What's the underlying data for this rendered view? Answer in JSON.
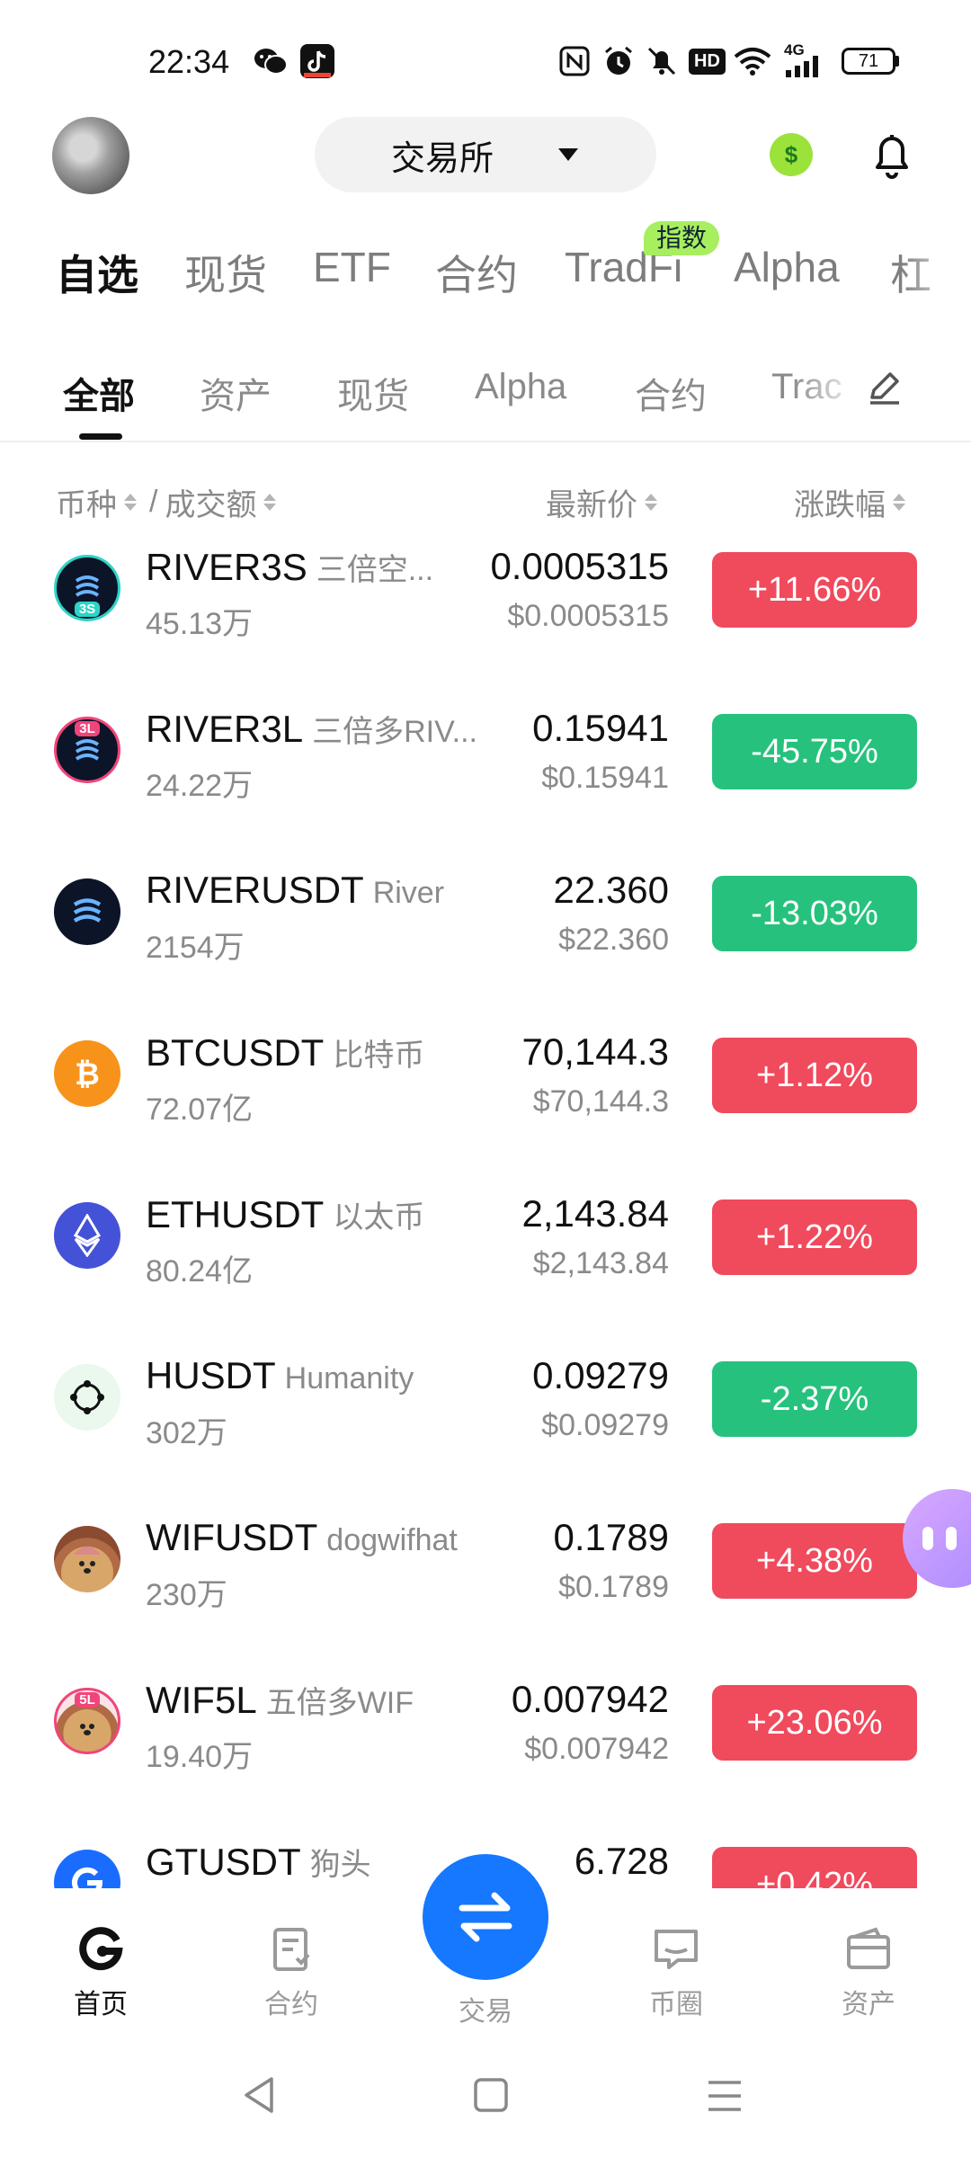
{
  "status_bar": {
    "time": "22:34",
    "hd": "HD",
    "network": "4G",
    "battery": "71"
  },
  "header": {
    "exchange_label": "交易所",
    "dollar_symbol": "$"
  },
  "main_tabs": [
    {
      "label": "自选",
      "active": true
    },
    {
      "label": "现货",
      "active": false
    },
    {
      "label": "ETF",
      "active": false
    },
    {
      "label": "合约",
      "active": false
    },
    {
      "label": "TradFi",
      "active": false
    },
    {
      "label": "Alpha",
      "active": false
    },
    {
      "label": "杠",
      "active": false
    }
  ],
  "tradfi_badge": "指数",
  "sub_tabs": [
    {
      "label": "全部",
      "active": true
    },
    {
      "label": "资产",
      "active": false
    },
    {
      "label": "现货",
      "active": false
    },
    {
      "label": "Alpha",
      "active": false
    },
    {
      "label": "合约",
      "active": false
    },
    {
      "label": "Trac",
      "active": false
    }
  ],
  "columns": {
    "coin": "币种",
    "sep": "/",
    "volume": "成交额",
    "price": "最新价",
    "change": "涨跌幅"
  },
  "rows": [
    {
      "symbol": "RIVER3S",
      "name": "三倍空...",
      "volume": "45.13万",
      "price": "0.0005315",
      "price_usd": "$0.0005315",
      "change": "+11.66%",
      "dir": "up"
    },
    {
      "symbol": "RIVER3L",
      "name": "三倍多RIV...",
      "volume": "24.22万",
      "price": "0.15941",
      "price_usd": "$0.15941",
      "change": "-45.75%",
      "dir": "down"
    },
    {
      "symbol": "RIVERUSDT",
      "name": "River",
      "volume": "2154万",
      "price": "22.360",
      "price_usd": "$22.360",
      "change": "-13.03%",
      "dir": "down"
    },
    {
      "symbol": "BTCUSDT",
      "name": "比特币",
      "volume": "72.07亿",
      "price": "70,144.3",
      "price_usd": "$70,144.3",
      "change": "+1.12%",
      "dir": "up"
    },
    {
      "symbol": "ETHUSDT",
      "name": "以太币",
      "volume": "80.24亿",
      "price": "2,143.84",
      "price_usd": "$2,143.84",
      "change": "+1.22%",
      "dir": "up"
    },
    {
      "symbol": "HUSDT",
      "name": "Humanity",
      "volume": "302万",
      "price": "0.09279",
      "price_usd": "$0.09279",
      "change": "-2.37%",
      "dir": "down"
    },
    {
      "symbol": "WIFUSDT",
      "name": "dogwifhat",
      "volume": "230万",
      "price": "0.1789",
      "price_usd": "$0.1789",
      "change": "+4.38%",
      "dir": "up"
    },
    {
      "symbol": "WIF5L",
      "name": "五倍多WIF",
      "volume": "19.40万",
      "price": "0.007942",
      "price_usd": "$0.007942",
      "change": "+23.06%",
      "dir": "up"
    },
    {
      "symbol": "GTUSDT",
      "name": "狗头",
      "volume": "",
      "price": "6.728",
      "price_usd": "",
      "change": "+0.42%",
      "dir": "up"
    }
  ],
  "icon_badges": {
    "river3s": "3S",
    "river3l": "3L",
    "wif5l": "5L"
  },
  "bottom_nav": {
    "home": "首页",
    "futures": "合约",
    "trade": "交易",
    "community": "币圈",
    "assets": "资产"
  },
  "colors": {
    "up": "#f04a5d",
    "down": "#26c27d",
    "accent": "#1677ff"
  }
}
